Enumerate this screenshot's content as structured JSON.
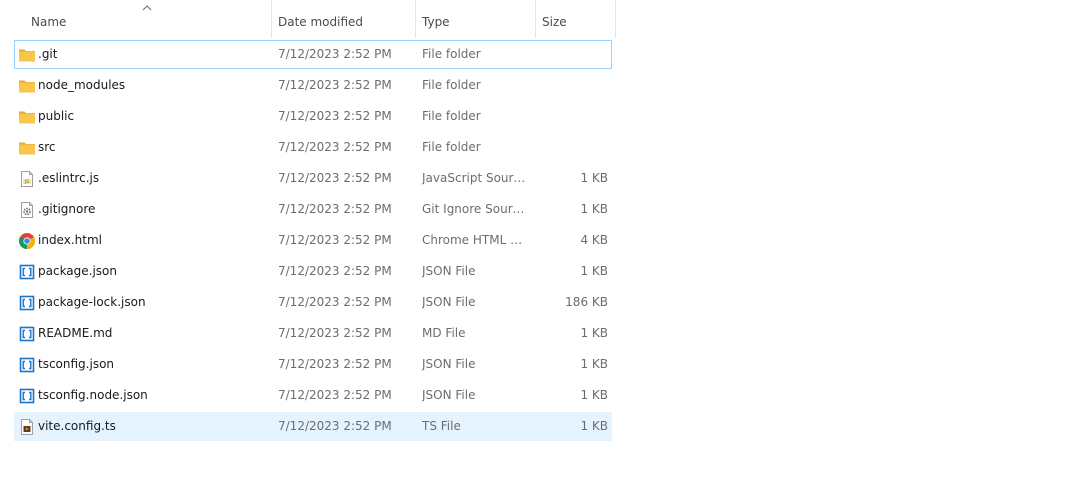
{
  "columns": {
    "name": "Name",
    "date": "Date modified",
    "type": "Type",
    "size": "Size"
  },
  "sort": {
    "column": "name",
    "direction": "ascending",
    "icon": "chevron-up-icon"
  },
  "files": [
    {
      "name": ".git",
      "date": "7/12/2023 2:52 PM",
      "type": "File folder",
      "size": "",
      "icon": "folder-icon",
      "state": "focused"
    },
    {
      "name": "node_modules",
      "date": "7/12/2023 2:52 PM",
      "type": "File folder",
      "size": "",
      "icon": "folder-icon",
      "state": ""
    },
    {
      "name": "public",
      "date": "7/12/2023 2:52 PM",
      "type": "File folder",
      "size": "",
      "icon": "folder-icon",
      "state": ""
    },
    {
      "name": "src",
      "date": "7/12/2023 2:52 PM",
      "type": "File folder",
      "size": "",
      "icon": "folder-icon",
      "state": ""
    },
    {
      "name": ".eslintrc.js",
      "date": "7/12/2023 2:52 PM",
      "type": "JavaScript Source ...",
      "size": "1 KB",
      "icon": "js-file-icon",
      "state": ""
    },
    {
      "name": ".gitignore",
      "date": "7/12/2023 2:52 PM",
      "type": "Git Ignore Source ...",
      "size": "1 KB",
      "icon": "settings-file-icon",
      "state": ""
    },
    {
      "name": "index.html",
      "date": "7/12/2023 2:52 PM",
      "type": "Chrome HTML Do...",
      "size": "4 KB",
      "icon": "chrome-icon",
      "state": ""
    },
    {
      "name": "package.json",
      "date": "7/12/2023 2:52 PM",
      "type": "JSON File",
      "size": "1 KB",
      "icon": "vscode-file-icon",
      "state": ""
    },
    {
      "name": "package-lock.json",
      "date": "7/12/2023 2:52 PM",
      "type": "JSON File",
      "size": "186 KB",
      "icon": "vscode-file-icon",
      "state": ""
    },
    {
      "name": "README.md",
      "date": "7/12/2023 2:52 PM",
      "type": "MD File",
      "size": "1 KB",
      "icon": "vscode-file-icon",
      "state": ""
    },
    {
      "name": "tsconfig.json",
      "date": "7/12/2023 2:52 PM",
      "type": "JSON File",
      "size": "1 KB",
      "icon": "vscode-file-icon",
      "state": ""
    },
    {
      "name": "tsconfig.node.json",
      "date": "7/12/2023 2:52 PM",
      "type": "JSON File",
      "size": "1 KB",
      "icon": "vscode-file-icon",
      "state": ""
    },
    {
      "name": "vite.config.ts",
      "date": "7/12/2023 2:52 PM",
      "type": "TS File",
      "size": "1 KB",
      "icon": "ts-file-icon",
      "state": "selected"
    }
  ],
  "colors": {
    "focus_border": "#99d1ff",
    "selected_bg": "#e5f3ff",
    "folder_yellow": "#f8c64a",
    "vscode_blue": "#1e74c8"
  }
}
